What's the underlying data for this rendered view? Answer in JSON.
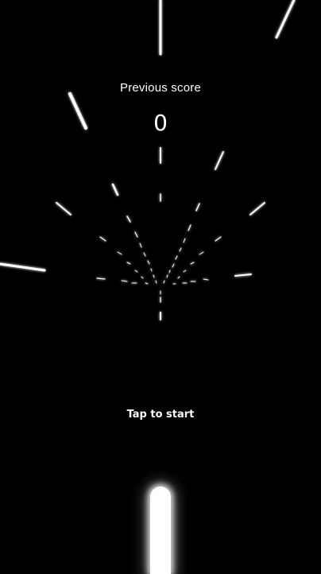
{
  "hud": {
    "previous_score_label": "Previous score",
    "previous_score_value": "0",
    "tap_to_start": "Tap to start"
  },
  "colors": {
    "background": "#000000",
    "lines": "#ffffff"
  },
  "icons": {
    "player": "glowing-bar-icon"
  }
}
